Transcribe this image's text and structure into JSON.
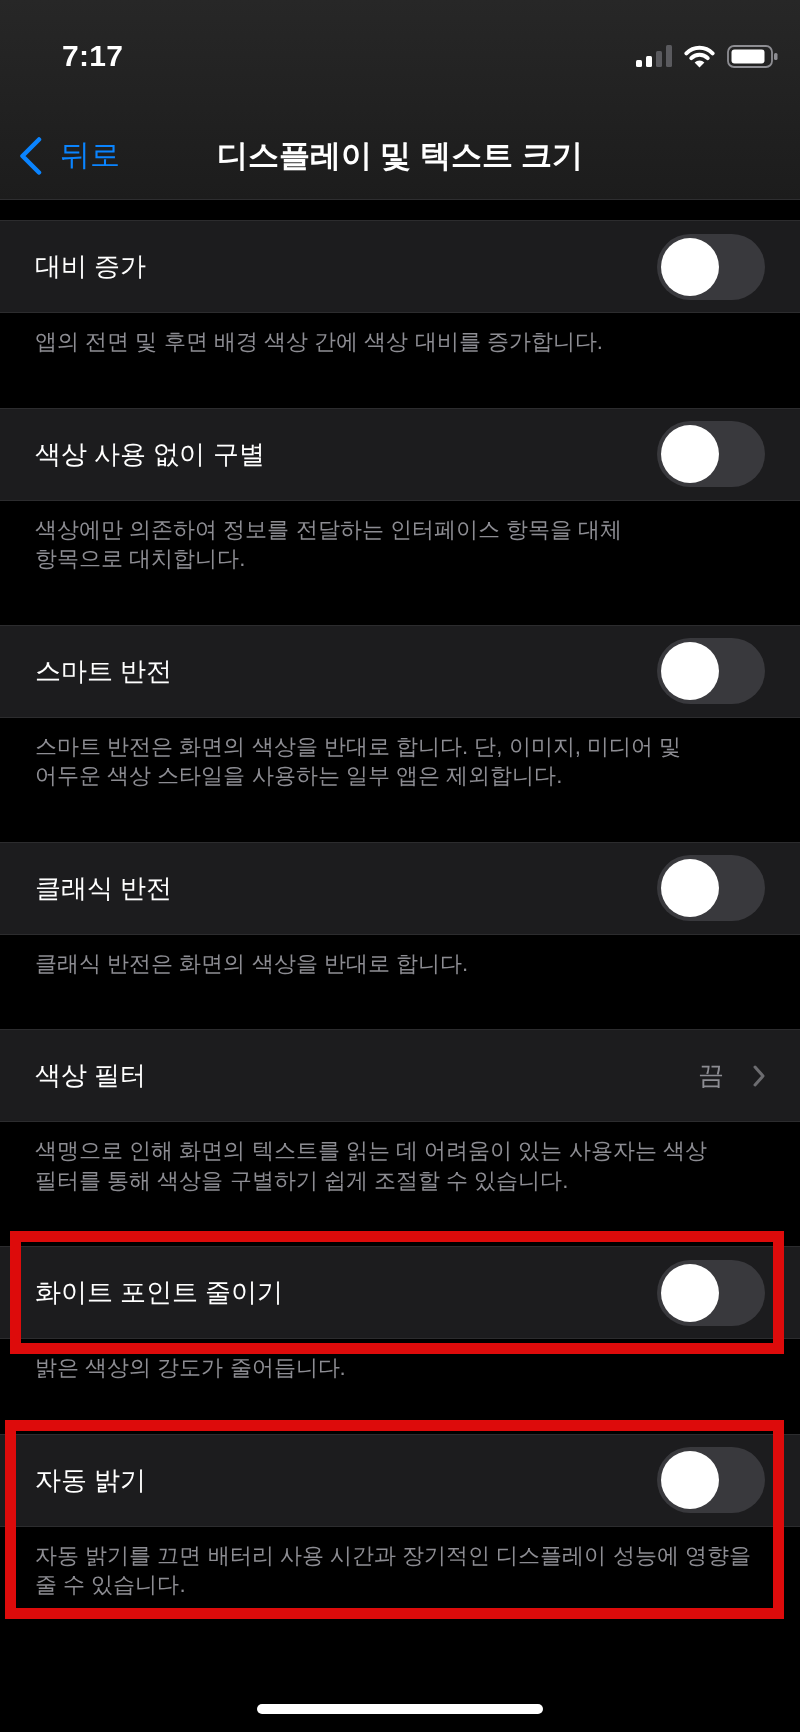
{
  "status_bar": {
    "time": "7:17"
  },
  "nav_bar": {
    "back_label": "뒤로",
    "title": "디스플레이 및 텍스트 크기"
  },
  "sections": [
    {
      "label": "대비 증가",
      "kind": "toggle",
      "on": false,
      "highlighted": false,
      "note_highlighted": false,
      "note": "앱의 전면 및 후면 배경 색상 간에 색상 대비를 증가합니다."
    },
    {
      "label": "색상 사용 없이 구별",
      "kind": "toggle",
      "on": false,
      "highlighted": false,
      "note_highlighted": false,
      "note": "색상에만 의존하여 정보를 전달하는 인터페이스 항목을 대체\n항목으로 대치합니다."
    },
    {
      "label": "스마트 반전",
      "kind": "toggle",
      "on": false,
      "highlighted": false,
      "note_highlighted": false,
      "note": "스마트 반전은 화면의 색상을 반대로 합니다. 단, 이미지, 미디어 및\n어두운 색상 스타일을 사용하는 일부 앱은 제외합니다."
    },
    {
      "label": "클래식 반전",
      "kind": "toggle",
      "on": false,
      "highlighted": false,
      "note_highlighted": false,
      "note": "클래식 반전은 화면의 색상을 반대로 합니다."
    },
    {
      "label": "색상 필터",
      "kind": "link",
      "value": "끔",
      "highlighted": false,
      "note_highlighted": false,
      "note": "색맹으로 인해 화면의 텍스트를 읽는 데 어려움이 있는 사용자는 색상\n필터를 통해 색상을 구별하기 쉽게 조절할 수 있습니다."
    },
    {
      "label": "화이트 포인트 줄이기",
      "kind": "toggle",
      "on": false,
      "highlighted": true,
      "note_highlighted": false,
      "note": "밝은 색상의 강도가 줄어듭니다."
    },
    {
      "label": "자동 밝기",
      "kind": "toggle",
      "on": false,
      "highlighted": true,
      "note_highlighted": true,
      "note": "자동 밝기를 끄면 배터리 사용 시간과 장기적인 디스플레이 성능에 영향을\n줄 수 있습니다."
    }
  ]
}
